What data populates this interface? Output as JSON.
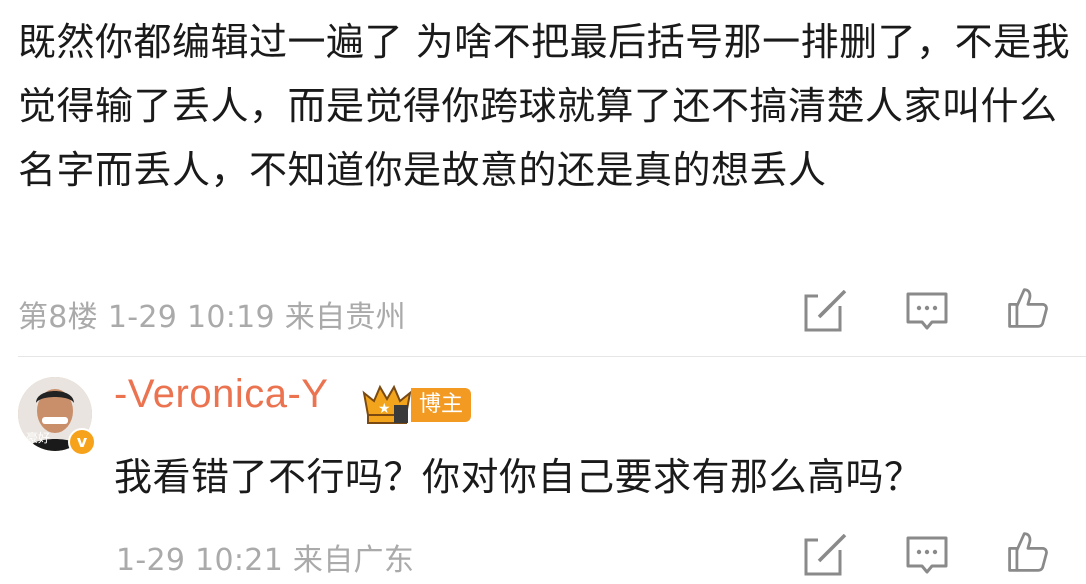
{
  "comment": {
    "text": "既然你都编辑过一遍了 为啥不把最后括号那一排删了，不是我觉得输了丢人，而是觉得你跨球就算了还不搞清楚人家叫什么名字而丢人，不知道你是故意的还是真的想丢人",
    "floor": "第8楼",
    "time": "1-29 10:19",
    "location": "来自贵州"
  },
  "reply": {
    "username": "-Veronica-Y",
    "badge": "博主",
    "avatar_caption": "豪好",
    "verified_glyph": "v",
    "text": "我看错了不行吗？你对你自己要求有那么高吗？",
    "time": "1-29 10:21",
    "location": "来自广东"
  },
  "icons": {
    "edit": "edit-icon",
    "comment": "comment-icon",
    "like": "like-icon",
    "crown": "crown-icon"
  },
  "colors": {
    "username": "#eb7350",
    "badge": "#f29a21",
    "meta": "#aaaaaa",
    "verified": "#f7a21b"
  }
}
